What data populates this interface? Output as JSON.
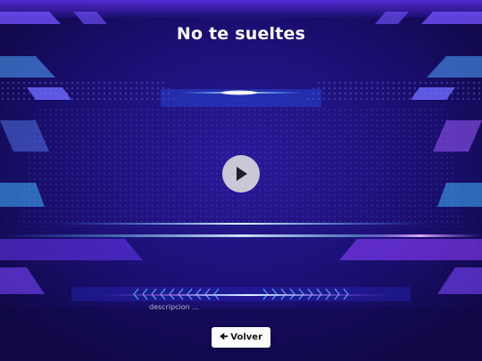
{
  "page": {
    "title": "No te sueltes",
    "description": "descripcion ...",
    "back_label": "Volver",
    "back_icon": "arrow-left-icon",
    "play_icon": "play-icon"
  },
  "colors": {
    "background": "#140a55",
    "accent_blue": "#3fb6ff",
    "accent_purple": "#a24bff",
    "play_button": "#ccc7d6",
    "button_bg": "#ffffff"
  }
}
